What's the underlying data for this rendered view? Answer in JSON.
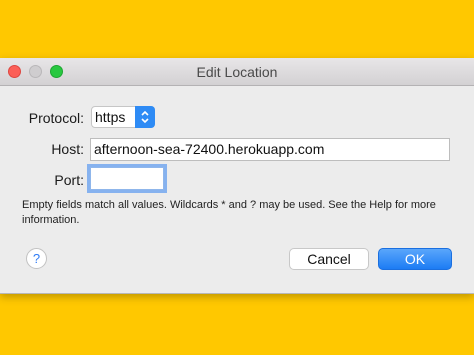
{
  "window": {
    "title": "Edit Location"
  },
  "form": {
    "protocol_label": "Protocol:",
    "protocol_value": "https",
    "host_label": "Host:",
    "host_value": "afternoon-sea-72400.herokuapp.com",
    "port_label": "Port:",
    "port_value": ""
  },
  "hint": "Empty fields match all values. Wildcards * and ? may be used. See the Help for more information.",
  "buttons": {
    "help": "?",
    "cancel": "Cancel",
    "ok": "OK"
  },
  "colors": {
    "background": "#FFC800",
    "accent": "#2E8BF5",
    "close": "#FC5F57",
    "zoom": "#28C840"
  },
  "icons": {
    "dropdown": "chevron-updown-icon",
    "help": "question-mark-icon"
  }
}
